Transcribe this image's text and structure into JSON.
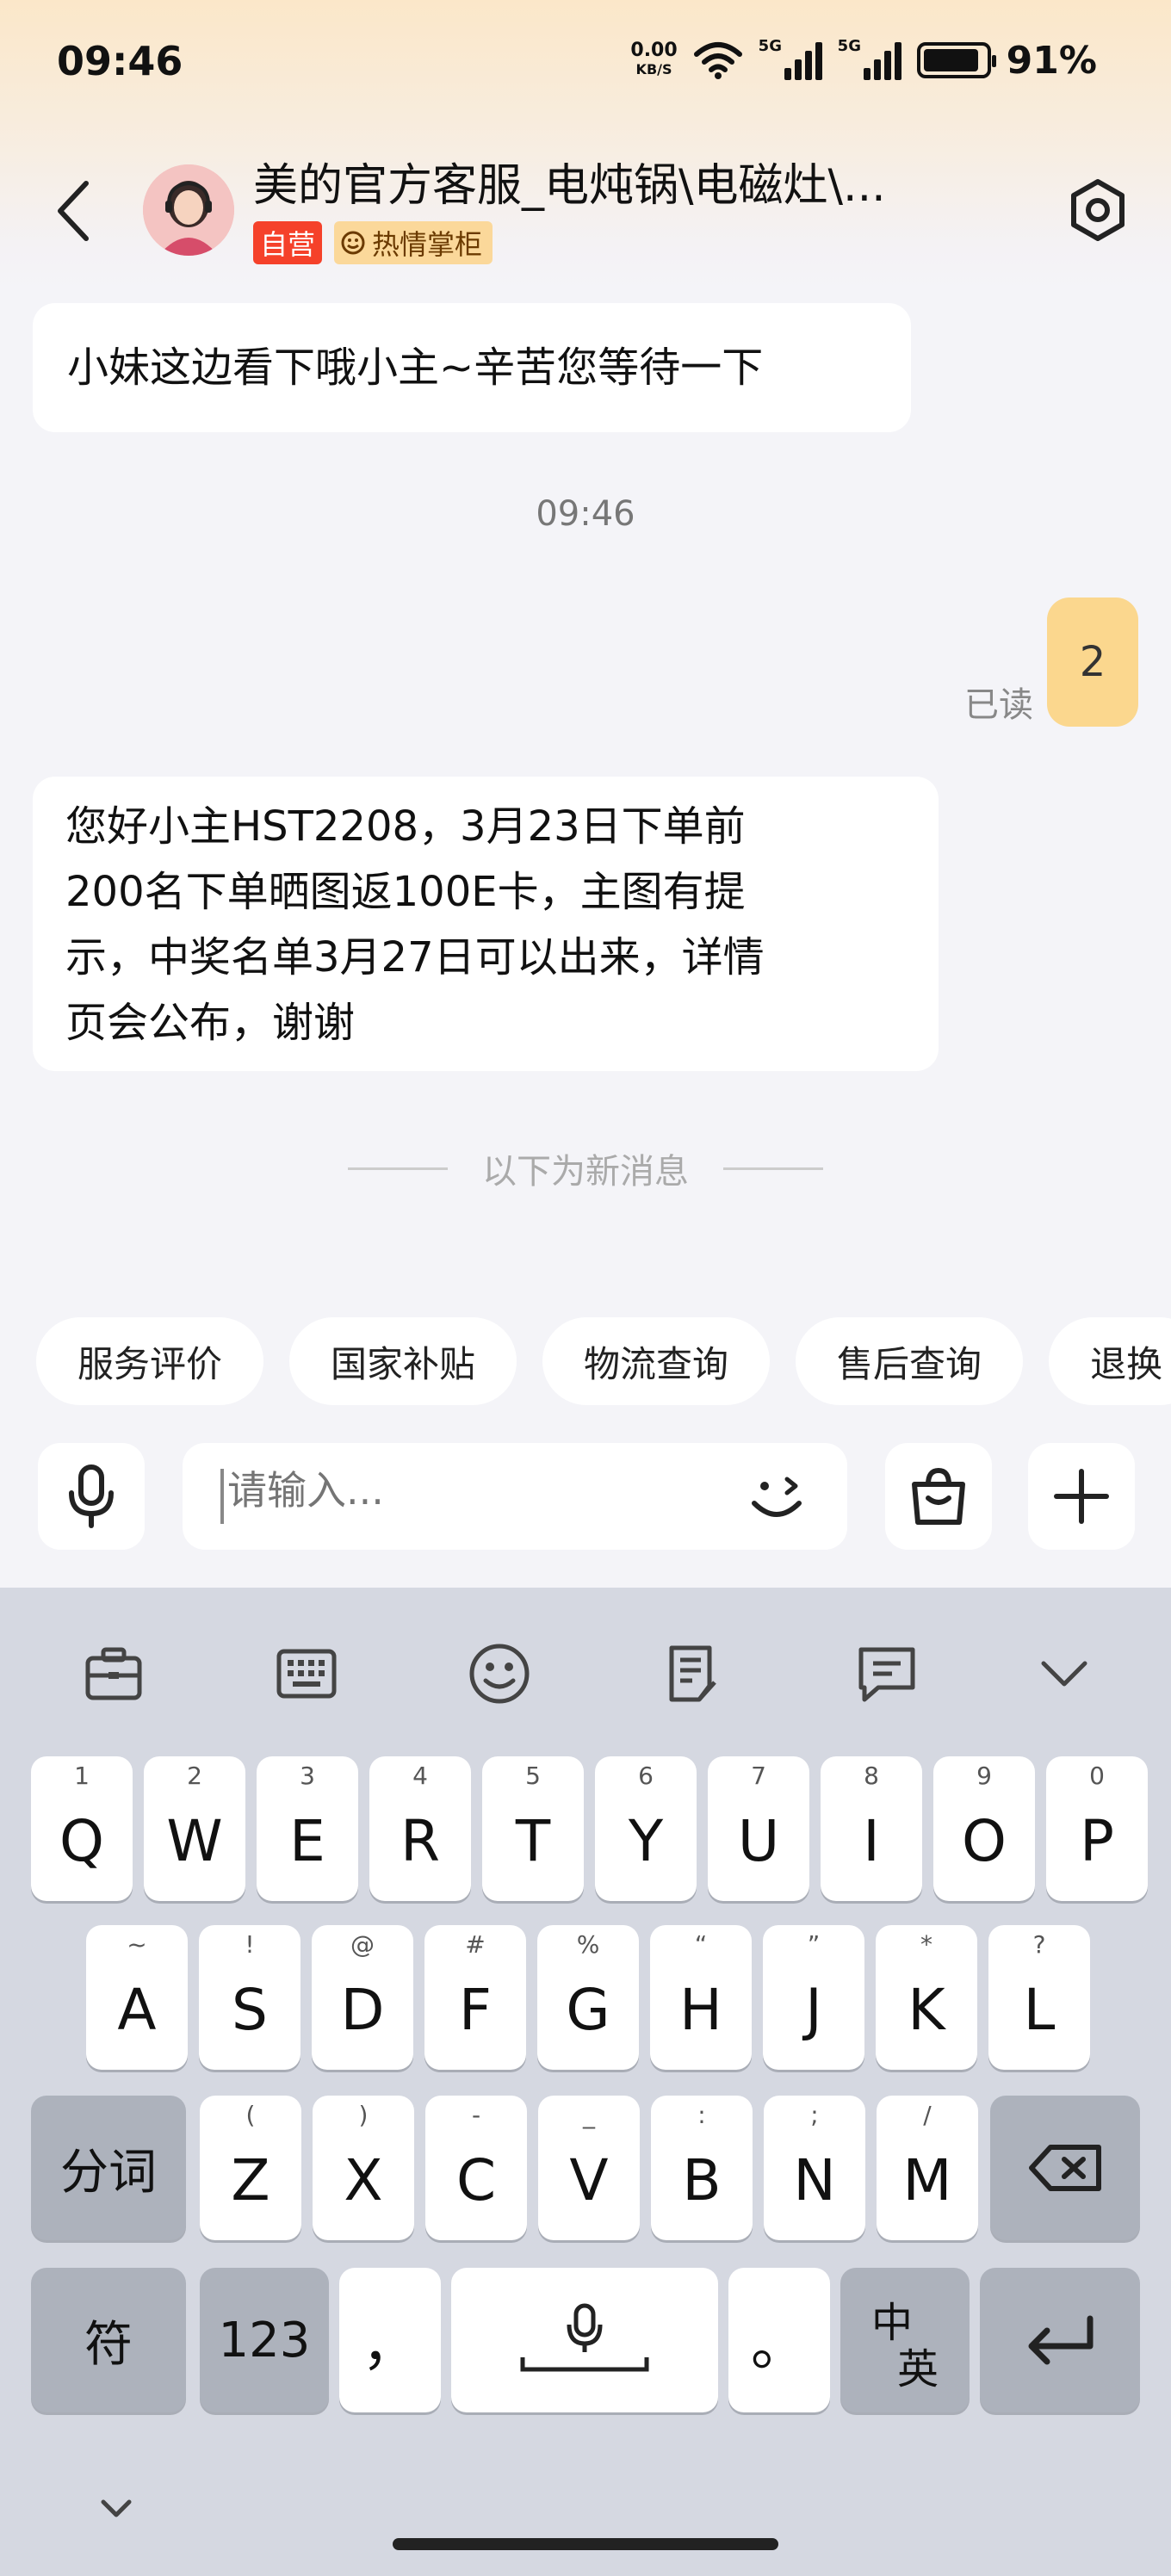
{
  "status_bar": {
    "time": "09:46",
    "net_speed": "0.00",
    "net_unit": "KB/S",
    "signal1": "5G",
    "signal2": "5G",
    "battery": "91%",
    "battery_level": 0.91
  },
  "header": {
    "title": "美的官方客服_电炖锅\\电磁灶\\...",
    "tag_self": "自营",
    "tag_hot": "热情掌柜"
  },
  "messages": {
    "msg1": "小妹这边看下哦小主~辛苦您等待一下",
    "timestamp": "09:46",
    "self_msg": "2",
    "read_label": "已读",
    "msg2_lines": [
      "您好小主HST2208，3月23日下单前",
      "200名下单晒图返100E卡，主图有提",
      "示，中奖名单3月27日可以出来，详情",
      "页会公布，谢谢"
    ],
    "new_divider": "以下为新消息"
  },
  "quick_replies": [
    "服务评价",
    "国家补贴",
    "物流查询",
    "售后查询",
    "退换"
  ],
  "input": {
    "placeholder": "请输入..."
  },
  "keyboard": {
    "row1": [
      {
        "k": "Q",
        "n": "1"
      },
      {
        "k": "W",
        "n": "2"
      },
      {
        "k": "E",
        "n": "3"
      },
      {
        "k": "R",
        "n": "4"
      },
      {
        "k": "T",
        "n": "5"
      },
      {
        "k": "Y",
        "n": "6"
      },
      {
        "k": "U",
        "n": "7"
      },
      {
        "k": "I",
        "n": "8"
      },
      {
        "k": "O",
        "n": "9"
      },
      {
        "k": "P",
        "n": "0"
      }
    ],
    "row2": [
      {
        "k": "A",
        "n": "~"
      },
      {
        "k": "S",
        "n": "!"
      },
      {
        "k": "D",
        "n": "@"
      },
      {
        "k": "F",
        "n": "#"
      },
      {
        "k": "G",
        "n": "%"
      },
      {
        "k": "H",
        "n": "“"
      },
      {
        "k": "J",
        "n": "”"
      },
      {
        "k": "K",
        "n": "*"
      },
      {
        "k": "L",
        "n": "?"
      }
    ],
    "row3": [
      {
        "k": "Z",
        "n": "("
      },
      {
        "k": "X",
        "n": ")"
      },
      {
        "k": "C",
        "n": "-"
      },
      {
        "k": "V",
        "n": "_"
      },
      {
        "k": "B",
        "n": ":"
      },
      {
        "k": "N",
        "n": ";"
      },
      {
        "k": "M",
        "n": "/"
      }
    ],
    "fenci": "分词",
    "fu": "符",
    "num123": "123",
    "comma": "，",
    "period": "。",
    "zh": "中",
    "en": "英"
  }
}
